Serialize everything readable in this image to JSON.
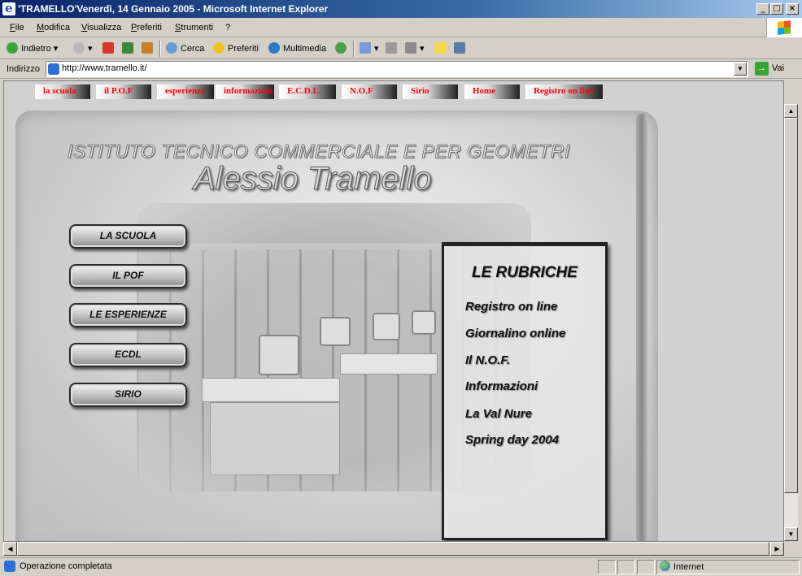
{
  "window": {
    "title": "'TRAMELLO'Venerdì, 14 Gennaio 2005 - Microsoft Internet Explorer",
    "controls": {
      "minimize": "_",
      "maximize": "□",
      "close": "×"
    }
  },
  "menu": [
    "File",
    "Modifica",
    "Visualizza",
    "Preferiti",
    "Strumenti",
    "?"
  ],
  "toolbar": {
    "back": "Indietro",
    "search": "Cerca",
    "favorites": "Preferiti",
    "media": "Multimedia"
  },
  "address": {
    "label": "Indirizzo",
    "url": "http://www.tramello.it/",
    "go": "Vai"
  },
  "site": {
    "topnav": [
      "la scuola",
      "il P.O.F",
      "esperienze",
      "informazioni",
      "E.C.D.L.",
      "N.O.F",
      "Sirio",
      "Home",
      "Registro on line"
    ],
    "institute": "ISTITUTO TECNICO COMMERCIALE E PER GEOMETRI",
    "name": "Alessio Tramello",
    "side_buttons": [
      "LA SCUOLA",
      "IL POF",
      "LE ESPERIENZE",
      "ECDL",
      "SIRIO"
    ],
    "rubriche": {
      "title": "LE RUBRICHE",
      "links": [
        "Registro on line",
        "Giornalino online",
        "Il N.O.F.",
        "Informazioni",
        "La Val Nure",
        "Spring day 2004"
      ]
    }
  },
  "status": {
    "text": "Operazione completata",
    "zone": "Internet"
  },
  "colors": {
    "titlebar": "#0a246a",
    "nav_text": "#ff0000",
    "chrome": "#d4d0c8"
  }
}
